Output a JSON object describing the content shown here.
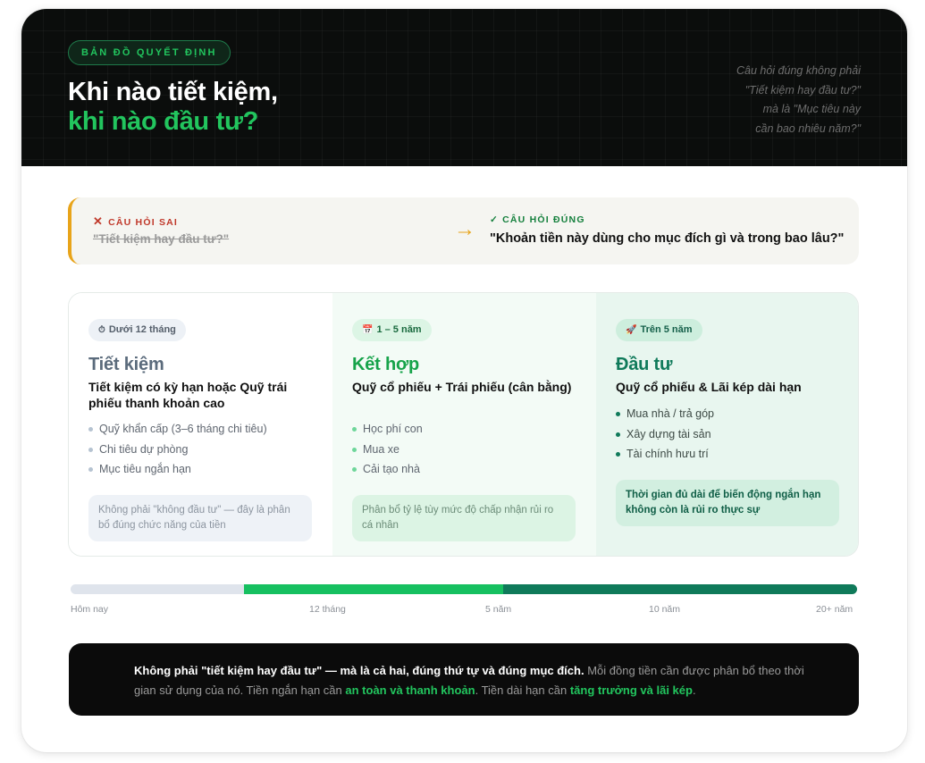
{
  "hero": {
    "badge": "BẢN ĐỒ QUYẾT ĐỊNH",
    "title_line1": "Khi nào tiết kiệm,",
    "title_line2": "khi nào đầu tư?",
    "quote": [
      "Câu hỏi đúng không phải",
      "\"Tiết kiệm hay đầu tư?\"",
      "mà là \"Mục tiêu này",
      "cần bao nhiêu năm?\""
    ]
  },
  "question": {
    "wrong_label": "CÂU HỎI SAI",
    "wrong_text": "\"Tiết kiệm hay đầu tư?\"",
    "arrow": "→",
    "right_label": "✓ CÂU HỎI ĐÚNG",
    "right_text": "\"Khoản tiền này dùng cho mục đích gì và trong bao lâu?\""
  },
  "columns": [
    {
      "pill_icon": "⏱",
      "pill": "Dưới 12 tháng",
      "title": "Tiết kiệm",
      "subtitle": "Tiết kiệm có kỳ hạn hoặc Quỹ trái phiếu thanh khoản cao",
      "items": [
        "Quỹ khẩn cấp (3–6 tháng chi tiêu)",
        "Chi tiêu dự phòng",
        "Mục tiêu ngắn hạn"
      ],
      "note": "Không phải \"không đầu tư\" — đây là phân bổ đúng chức năng của tiền"
    },
    {
      "pill_icon": "📅",
      "pill": "1 – 5 năm",
      "title": "Kết hợp",
      "subtitle": "Quỹ cổ phiếu + Trái phiếu (cân bằng)",
      "items": [
        "Học phí con",
        "Mua xe",
        "Cải tạo nhà"
      ],
      "note": "Phân bổ tỷ lệ tùy mức độ chấp nhận rủi ro cá nhân"
    },
    {
      "pill_icon": "🚀",
      "pill": "Trên 5 năm",
      "title": "Đầu tư",
      "subtitle": "Quỹ cổ phiếu & Lãi kép dài hạn",
      "items": [
        "Mua nhà / trả góp",
        "Xây dựng tài sản",
        "Tài chính hưu trí"
      ],
      "note": "Thời gian đủ dài để biến động ngắn hạn không còn là rủi ro thực sự"
    }
  ],
  "timeline": {
    "labels": [
      "Hôm nay",
      "12 tháng",
      "5 năm",
      "10 năm",
      "20+ năm"
    ],
    "colors": [
      "#dfe4ec",
      "#16c060",
      "#0f7a5a"
    ]
  },
  "summary": {
    "lead": "Không phải \"tiết kiệm hay đầu tư\" — mà là cả hai, đúng thứ tự và đúng mục đích.",
    "text1": " Mỗi đồng tiền cần được phân bổ theo thời gian sử dụng của nó. Tiền ngắn hạn cần ",
    "hl1": "an toàn và thanh khoản",
    "text2": ". Tiền dài hạn cần ",
    "hl2": "tăng trưởng và lãi kép",
    "text3": "."
  }
}
